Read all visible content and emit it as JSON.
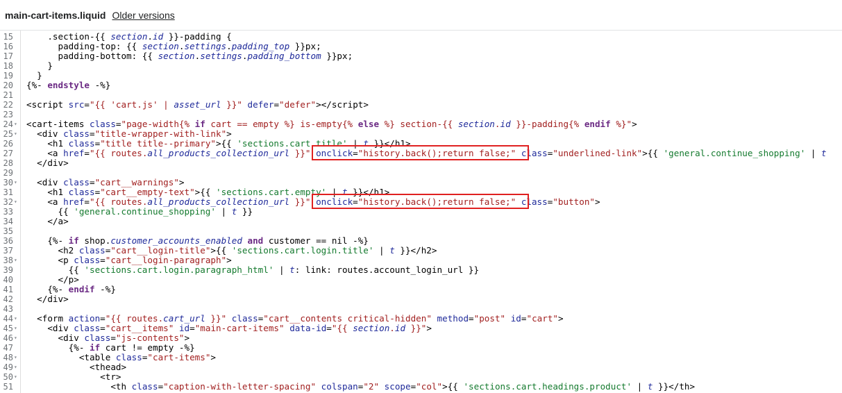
{
  "header": {
    "file_name": "main-cart-items.liquid",
    "older_versions_label": "Older versions"
  },
  "colors": {
    "highlight": "#e02020",
    "accent": "#008060"
  },
  "editor": {
    "lines": [
      {
        "n": "15",
        "fold": false,
        "segs": [
          [
            "pl",
            "    .section-{{ "
          ],
          [
            "var",
            "section"
          ],
          [
            "pl",
            "."
          ],
          [
            "var",
            "id"
          ],
          [
            "pl",
            " }}-padding {"
          ]
        ]
      },
      {
        "n": "16",
        "fold": false,
        "segs": [
          [
            "pl",
            "      padding-top: {{ "
          ],
          [
            "var",
            "section"
          ],
          [
            "pl",
            "."
          ],
          [
            "var",
            "settings"
          ],
          [
            "pl",
            "."
          ],
          [
            "var",
            "padding_top"
          ],
          [
            "pl",
            " }}px;"
          ]
        ]
      },
      {
        "n": "17",
        "fold": false,
        "segs": [
          [
            "pl",
            "      padding-bottom: {{ "
          ],
          [
            "var",
            "section"
          ],
          [
            "pl",
            "."
          ],
          [
            "var",
            "settings"
          ],
          [
            "pl",
            "."
          ],
          [
            "var",
            "padding_bottom"
          ],
          [
            "pl",
            " }}px;"
          ]
        ]
      },
      {
        "n": "18",
        "fold": false,
        "segs": [
          [
            "pl",
            "    }"
          ]
        ]
      },
      {
        "n": "19",
        "fold": false,
        "segs": [
          [
            "pl",
            "  }"
          ]
        ]
      },
      {
        "n": "20",
        "fold": false,
        "segs": [
          [
            "pl",
            "{%- "
          ],
          [
            "kw",
            "endstyle"
          ],
          [
            "pl",
            " -%}"
          ]
        ]
      },
      {
        "n": "21",
        "fold": false,
        "segs": []
      },
      {
        "n": "22",
        "fold": false,
        "segs": [
          [
            "pl",
            "<script "
          ],
          [
            "attr",
            "src"
          ],
          [
            "pl",
            "="
          ],
          [
            "str",
            "\"{{ 'cart.js' | "
          ],
          [
            "fil",
            "asset_url"
          ],
          [
            "str",
            " }}\""
          ],
          [
            "pl",
            " "
          ],
          [
            "attr",
            "defer"
          ],
          [
            "pl",
            "="
          ],
          [
            "str",
            "\"defer\""
          ],
          [
            "pl",
            "></"
          ],
          [
            "pl",
            "script>"
          ]
        ]
      },
      {
        "n": "23",
        "fold": false,
        "segs": []
      },
      {
        "n": "24",
        "fold": true,
        "segs": [
          [
            "pl",
            "<cart-items "
          ],
          [
            "attr",
            "class"
          ],
          [
            "pl",
            "="
          ],
          [
            "str",
            "\"page-width{% "
          ],
          [
            "kw",
            "if"
          ],
          [
            "str",
            " cart == empty %} is-empty{% "
          ],
          [
            "kw",
            "else"
          ],
          [
            "str",
            " %} section-{{ "
          ],
          [
            "var",
            "section"
          ],
          [
            "str",
            "."
          ],
          [
            "var",
            "id"
          ],
          [
            "str",
            " }}-padding{% "
          ],
          [
            "kw",
            "endif"
          ],
          [
            "str",
            " %}\""
          ],
          [
            "pl",
            ">"
          ]
        ]
      },
      {
        "n": "25",
        "fold": true,
        "segs": [
          [
            "pl",
            "  <div "
          ],
          [
            "attr",
            "class"
          ],
          [
            "pl",
            "="
          ],
          [
            "str",
            "\"title-wrapper-with-link\""
          ],
          [
            "pl",
            ">"
          ]
        ]
      },
      {
        "n": "26",
        "fold": false,
        "segs": [
          [
            "pl",
            "    <h1 "
          ],
          [
            "attr",
            "class"
          ],
          [
            "pl",
            "="
          ],
          [
            "str",
            "\"title title--primary\""
          ],
          [
            "pl",
            ">{{ "
          ],
          [
            "strg",
            "'sections.cart.title'"
          ],
          [
            "pl",
            " | "
          ],
          [
            "fil",
            "t"
          ],
          [
            "pl",
            " }}</h1>"
          ]
        ]
      },
      {
        "n": "27",
        "fold": false,
        "segs": [
          [
            "pl",
            "    <a "
          ],
          [
            "attr",
            "href"
          ],
          [
            "pl",
            "="
          ],
          [
            "str",
            "\"{{ routes."
          ],
          [
            "var",
            "all_products_collection_url"
          ],
          [
            "str",
            " }}\""
          ],
          [
            "pl",
            " "
          ],
          [
            "attr",
            "onclick"
          ],
          [
            "pl",
            "="
          ],
          [
            "str",
            "\"history.back();return false;\""
          ],
          [
            "pl",
            " "
          ],
          [
            "attr",
            "class"
          ],
          [
            "pl",
            "="
          ],
          [
            "str",
            "\"underlined-link\""
          ],
          [
            "pl",
            ">{{ "
          ],
          [
            "strg",
            "'general.continue_shopping'"
          ],
          [
            "pl",
            " | "
          ],
          [
            "fil",
            "t"
          ]
        ]
      },
      {
        "n": "28",
        "fold": false,
        "segs": [
          [
            "pl",
            "  </div>"
          ]
        ]
      },
      {
        "n": "29",
        "fold": false,
        "segs": []
      },
      {
        "n": "30",
        "fold": true,
        "segs": [
          [
            "pl",
            "  <div "
          ],
          [
            "attr",
            "class"
          ],
          [
            "pl",
            "="
          ],
          [
            "str",
            "\"cart__warnings\""
          ],
          [
            "pl",
            ">"
          ]
        ]
      },
      {
        "n": "31",
        "fold": false,
        "segs": [
          [
            "pl",
            "    <h1 "
          ],
          [
            "attr",
            "class"
          ],
          [
            "pl",
            "="
          ],
          [
            "str",
            "\"cart__empty-text\""
          ],
          [
            "pl",
            ">{{ "
          ],
          [
            "strg",
            "'sections.cart.empty'"
          ],
          [
            "pl",
            " | "
          ],
          [
            "fil",
            "t"
          ],
          [
            "pl",
            " }}</h1>"
          ]
        ]
      },
      {
        "n": "32",
        "fold": true,
        "segs": [
          [
            "pl",
            "    <a "
          ],
          [
            "attr",
            "href"
          ],
          [
            "pl",
            "="
          ],
          [
            "str",
            "\"{{ routes."
          ],
          [
            "var",
            "all_products_collection_url"
          ],
          [
            "str",
            " }}\""
          ],
          [
            "pl",
            " "
          ],
          [
            "attr",
            "onclick"
          ],
          [
            "pl",
            "="
          ],
          [
            "str",
            "\"history.back();return false;\""
          ],
          [
            "pl",
            " "
          ],
          [
            "attr",
            "class"
          ],
          [
            "pl",
            "="
          ],
          [
            "str",
            "\"button\""
          ],
          [
            "pl",
            ">"
          ]
        ]
      },
      {
        "n": "33",
        "fold": false,
        "segs": [
          [
            "pl",
            "      {{ "
          ],
          [
            "strg",
            "'general.continue_shopping'"
          ],
          [
            "pl",
            " | "
          ],
          [
            "fil",
            "t"
          ],
          [
            "pl",
            " }}"
          ]
        ]
      },
      {
        "n": "34",
        "fold": false,
        "segs": [
          [
            "pl",
            "    </a>"
          ]
        ]
      },
      {
        "n": "35",
        "fold": false,
        "segs": []
      },
      {
        "n": "36",
        "fold": false,
        "segs": [
          [
            "pl",
            "    {%- "
          ],
          [
            "kw",
            "if"
          ],
          [
            "pl",
            " shop."
          ],
          [
            "var",
            "customer_accounts_enabled"
          ],
          [
            "pl",
            " "
          ],
          [
            "kw",
            "and"
          ],
          [
            "pl",
            " customer == nil -%}"
          ]
        ]
      },
      {
        "n": "37",
        "fold": false,
        "segs": [
          [
            "pl",
            "      <h2 "
          ],
          [
            "attr",
            "class"
          ],
          [
            "pl",
            "="
          ],
          [
            "str",
            "\"cart__login-title\""
          ],
          [
            "pl",
            ">{{ "
          ],
          [
            "strg",
            "'sections.cart.login.title'"
          ],
          [
            "pl",
            " | "
          ],
          [
            "fil",
            "t"
          ],
          [
            "pl",
            " }}</h2>"
          ]
        ]
      },
      {
        "n": "38",
        "fold": true,
        "segs": [
          [
            "pl",
            "      <p "
          ],
          [
            "attr",
            "class"
          ],
          [
            "pl",
            "="
          ],
          [
            "str",
            "\"cart__login-paragraph\""
          ],
          [
            "pl",
            ">"
          ]
        ]
      },
      {
        "n": "39",
        "fold": false,
        "segs": [
          [
            "pl",
            "        {{ "
          ],
          [
            "strg",
            "'sections.cart.login.paragraph_html'"
          ],
          [
            "pl",
            " | "
          ],
          [
            "fil",
            "t"
          ],
          [
            "pl",
            ": link: routes."
          ],
          [
            "pl",
            "account_login_url }}"
          ]
        ]
      },
      {
        "n": "40",
        "fold": false,
        "segs": [
          [
            "pl",
            "      </p>"
          ]
        ]
      },
      {
        "n": "41",
        "fold": false,
        "segs": [
          [
            "pl",
            "    {%- "
          ],
          [
            "kw",
            "endif"
          ],
          [
            "pl",
            " -%}"
          ]
        ]
      },
      {
        "n": "42",
        "fold": false,
        "segs": [
          [
            "pl",
            "  </div>"
          ]
        ]
      },
      {
        "n": "43",
        "fold": false,
        "segs": []
      },
      {
        "n": "44",
        "fold": true,
        "segs": [
          [
            "pl",
            "  <form "
          ],
          [
            "attr",
            "action"
          ],
          [
            "pl",
            "="
          ],
          [
            "str",
            "\"{{ routes."
          ],
          [
            "var",
            "cart_url"
          ],
          [
            "str",
            " }}\""
          ],
          [
            "pl",
            " "
          ],
          [
            "attr",
            "class"
          ],
          [
            "pl",
            "="
          ],
          [
            "str",
            "\"cart__contents critical-hidden\""
          ],
          [
            "pl",
            " "
          ],
          [
            "attr",
            "method"
          ],
          [
            "pl",
            "="
          ],
          [
            "str",
            "\"post\""
          ],
          [
            "pl",
            " "
          ],
          [
            "attr",
            "id"
          ],
          [
            "pl",
            "="
          ],
          [
            "str",
            "\"cart\""
          ],
          [
            "pl",
            ">"
          ]
        ]
      },
      {
        "n": "45",
        "fold": true,
        "segs": [
          [
            "pl",
            "    <div "
          ],
          [
            "attr",
            "class"
          ],
          [
            "pl",
            "="
          ],
          [
            "str",
            "\"cart__items\""
          ],
          [
            "pl",
            " "
          ],
          [
            "attr",
            "id"
          ],
          [
            "pl",
            "="
          ],
          [
            "str",
            "\"main-cart-items\""
          ],
          [
            "pl",
            " "
          ],
          [
            "attr",
            "data-id"
          ],
          [
            "pl",
            "="
          ],
          [
            "str",
            "\"{{ "
          ],
          [
            "var",
            "section"
          ],
          [
            "str",
            "."
          ],
          [
            "var",
            "id"
          ],
          [
            "str",
            " }}\""
          ],
          [
            "pl",
            ">"
          ]
        ]
      },
      {
        "n": "46",
        "fold": true,
        "segs": [
          [
            "pl",
            "      <div "
          ],
          [
            "attr",
            "class"
          ],
          [
            "pl",
            "="
          ],
          [
            "str",
            "\"js-contents\""
          ],
          [
            "pl",
            ">"
          ]
        ]
      },
      {
        "n": "47",
        "fold": false,
        "segs": [
          [
            "pl",
            "        {%- "
          ],
          [
            "kw",
            "if"
          ],
          [
            "pl",
            " cart != empty -%}"
          ]
        ]
      },
      {
        "n": "48",
        "fold": true,
        "segs": [
          [
            "pl",
            "          <table "
          ],
          [
            "attr",
            "class"
          ],
          [
            "pl",
            "="
          ],
          [
            "str",
            "\"cart-items\""
          ],
          [
            "pl",
            ">"
          ]
        ]
      },
      {
        "n": "49",
        "fold": true,
        "segs": [
          [
            "pl",
            "            <thead>"
          ]
        ]
      },
      {
        "n": "50",
        "fold": true,
        "segs": [
          [
            "pl",
            "              <tr>"
          ]
        ]
      },
      {
        "n": "51",
        "fold": false,
        "segs": [
          [
            "pl",
            "                <th "
          ],
          [
            "attr",
            "class"
          ],
          [
            "pl",
            "="
          ],
          [
            "str",
            "\"caption-with-letter-spacing\""
          ],
          [
            "pl",
            " "
          ],
          [
            "attr",
            "colspan"
          ],
          [
            "pl",
            "="
          ],
          [
            "str",
            "\"2\""
          ],
          [
            "pl",
            " "
          ],
          [
            "attr",
            "scope"
          ],
          [
            "pl",
            "="
          ],
          [
            "str",
            "\"col\""
          ],
          [
            "pl",
            ">{{ "
          ],
          [
            "strg",
            "'sections.cart.headings.product'"
          ],
          [
            "pl",
            " | "
          ],
          [
            "fil",
            "t"
          ],
          [
            "pl",
            " }}</th>"
          ]
        ]
      }
    ]
  }
}
